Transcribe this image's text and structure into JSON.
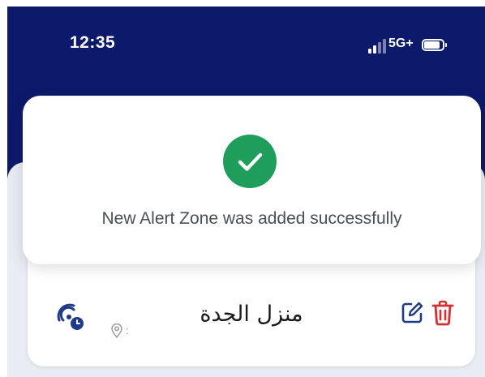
{
  "status_bar": {
    "time": "12:35",
    "network": "5G+",
    "signal_icon": "signal-bars-icon",
    "battery_icon": "battery-icon"
  },
  "toast": {
    "message": "New Alert Zone was added successfully",
    "icon": "check-circle-icon",
    "icon_color": "#1e9e5a"
  },
  "zone_card": {
    "name": "منزل الجدة",
    "address": ":",
    "zone_icon": "radar-clock-icon",
    "pin_icon": "location-pin-icon",
    "edit_icon": "edit-icon",
    "delete_icon": "trash-icon",
    "accent_color": "#1f3a8a",
    "delete_color": "#d32f2f"
  },
  "colors": {
    "header_background": "#0d1a6b",
    "panel_background": "#e9edf3"
  }
}
